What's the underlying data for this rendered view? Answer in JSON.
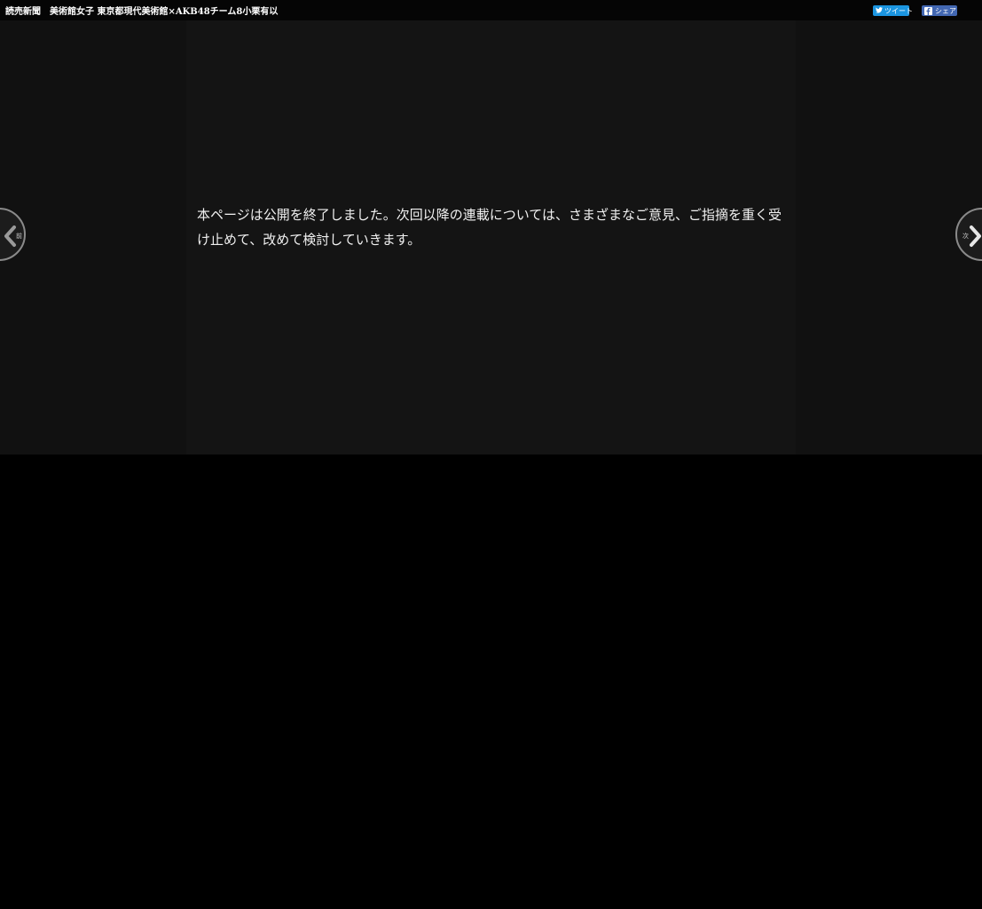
{
  "header": {
    "title": "読売新聞　美術館女子 東京都現代美術館×AKB48チーム8小栗有以",
    "tweet_label": "ツイート",
    "share_label": "シェア"
  },
  "main": {
    "notice": "本ページは公開を終了しました。次回以降の連載については、さまざまなご意見、ご指摘を重く受け止めて、改めて検討していきます。"
  },
  "nav": {
    "prev_label": "前",
    "next_label": "次"
  },
  "colors": {
    "topbar": "#050505",
    "stage": "#141414",
    "tweet_button": "#1b95e0",
    "share_button": "#4267b2"
  },
  "icons": {
    "tweet": "twitter-bird-icon",
    "share": "facebook-f-icon",
    "prev": "chevron-left-icon",
    "next": "chevron-right-icon"
  }
}
